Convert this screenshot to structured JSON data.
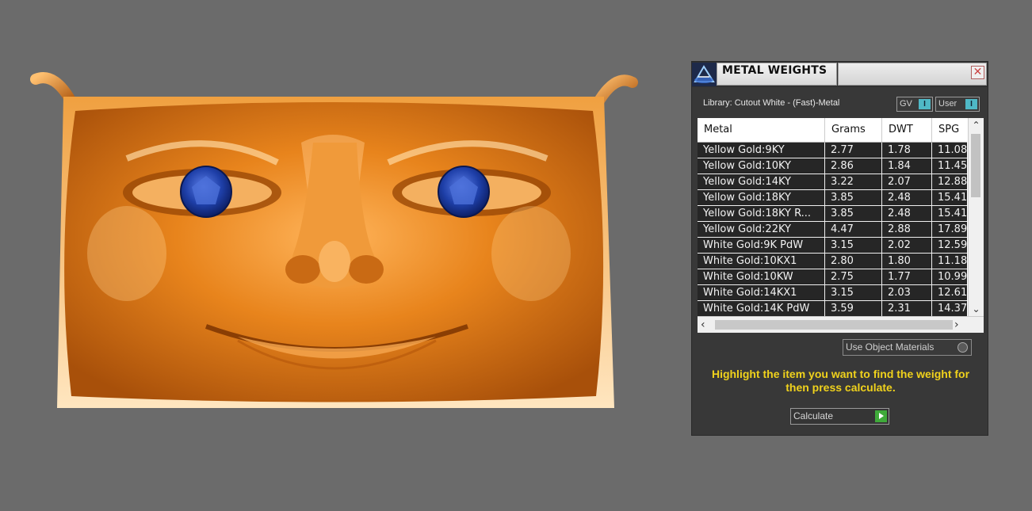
{
  "panel": {
    "title": "METAL WEIGHTS",
    "close_symbol": "✕",
    "library_label": "Library: Cutout White - (Fast)-Metal",
    "gv_toggle": "GV",
    "user_toggle": "User",
    "toggle_knob": "I",
    "columns": [
      "Metal",
      "Grams",
      "DWT",
      "SPG"
    ],
    "rows": [
      {
        "metal": "Yellow Gold:9KY",
        "grams": "2.77",
        "dwt": "1.78",
        "spg": "11.08"
      },
      {
        "metal": "Yellow Gold:10KY",
        "grams": "2.86",
        "dwt": "1.84",
        "spg": "11.45"
      },
      {
        "metal": "Yellow Gold:14KY",
        "grams": "3.22",
        "dwt": "2.07",
        "spg": "12.88"
      },
      {
        "metal": "Yellow Gold:18KY",
        "grams": "3.85",
        "dwt": "2.48",
        "spg": "15.41"
      },
      {
        "metal": "Yellow Gold:18KY R...",
        "grams": "3.85",
        "dwt": "2.48",
        "spg": "15.41"
      },
      {
        "metal": "Yellow Gold:22KY",
        "grams": "4.47",
        "dwt": "2.88",
        "spg": "17.89"
      },
      {
        "metal": "White Gold:9K PdW",
        "grams": "3.15",
        "dwt": "2.02",
        "spg": "12.59"
      },
      {
        "metal": "White Gold:10KX1",
        "grams": "2.80",
        "dwt": "1.80",
        "spg": "11.18"
      },
      {
        "metal": "White Gold:10KW",
        "grams": "2.75",
        "dwt": "1.77",
        "spg": "10.99"
      },
      {
        "metal": "White Gold:14KX1",
        "grams": "3.15",
        "dwt": "2.03",
        "spg": "12.61"
      },
      {
        "metal": "White Gold:14K PdW",
        "grams": "3.59",
        "dwt": "2.31",
        "spg": "14.37"
      }
    ],
    "use_object_materials": "Use Object Materials",
    "hint": "Highlight the item you want to find the weight for then press calculate.",
    "calculate_label": "Calculate"
  },
  "colors": {
    "background": "#6b6b6b",
    "model_gold": "#e07a12",
    "gem_blue": "#1e3fa8",
    "hint_yellow": "#f0d21c",
    "toggle_accent": "#4fb8c6",
    "calc_green": "#3faa3a"
  }
}
